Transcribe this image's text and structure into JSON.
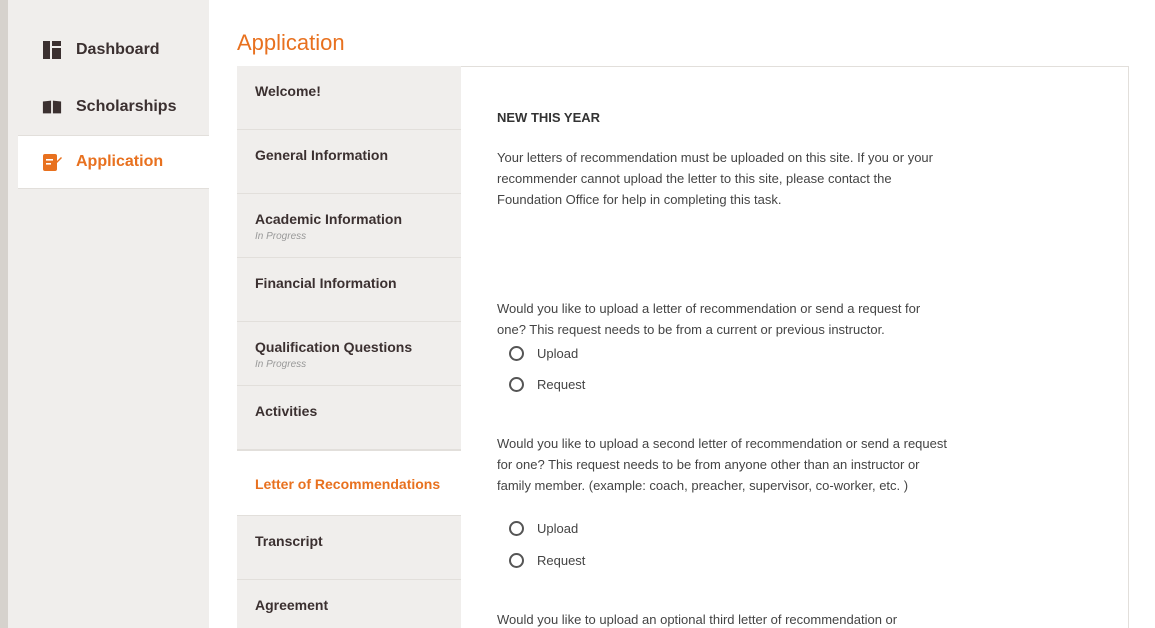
{
  "sidebar": {
    "items": [
      {
        "label": "Dashboard",
        "icon": "dashboard-icon"
      },
      {
        "label": "Scholarships",
        "icon": "book-icon"
      },
      {
        "label": "Application",
        "icon": "edit-document-icon",
        "active": true
      }
    ]
  },
  "page": {
    "title": "Application"
  },
  "tabs": [
    {
      "label": "Welcome!",
      "status": ""
    },
    {
      "label": "General Information",
      "status": ""
    },
    {
      "label": "Academic Information",
      "status": "In Progress"
    },
    {
      "label": "Financial Information",
      "status": ""
    },
    {
      "label": "Qualification Questions",
      "status": "In Progress"
    },
    {
      "label": "Activities",
      "status": ""
    },
    {
      "label": "Letter of Recommendations",
      "status": "",
      "active": true
    },
    {
      "label": "Transcript",
      "status": ""
    },
    {
      "label": "Agreement",
      "status": ""
    }
  ],
  "content": {
    "heading": "NEW THIS YEAR",
    "intro": "Your letters of recommendation must be uploaded on this site. If you or your recommender cannot upload the letter to this site, please contact the Foundation Office for help in completing this task.",
    "q1": "Would you like to upload a letter of recommendation or send a request for one? This request needs to be from a current or previous instructor.",
    "q2": "Would you like to upload a second letter of recommendation or send a request for one? This request needs to be from anyone other than an instructor or family member. (example: coach, preacher, supervisor, co-worker, etc. )",
    "q3": "Would you like to upload an optional third letter of recommendation or",
    "options": {
      "upload": "Upload",
      "request": "Request"
    }
  },
  "colors": {
    "accent": "#e8711f",
    "sidebar_bg": "#f0eeec",
    "text_dark": "#3b3030"
  }
}
